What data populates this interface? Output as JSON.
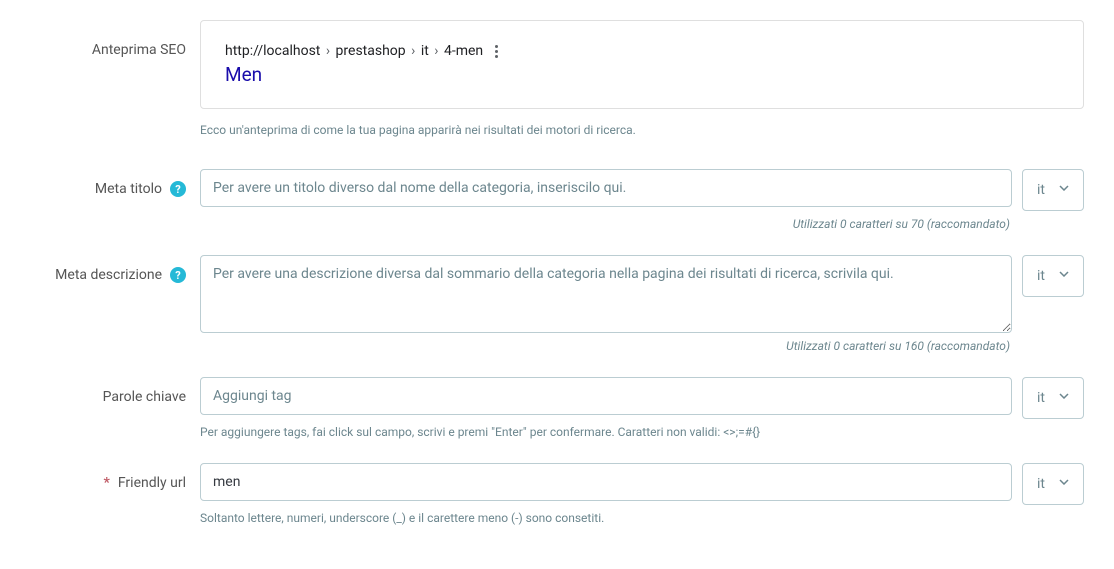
{
  "labels": {
    "seo_preview": "Anteprima SEO",
    "meta_title": "Meta titolo",
    "meta_description": "Meta descrizione",
    "keywords": "Parole chiave",
    "friendly_url": "Friendly url"
  },
  "seo_preview": {
    "url_base": "http://localhost",
    "url_parts": [
      "prestashop",
      "it",
      "4-men"
    ],
    "title": "Men",
    "help_text": "Ecco un'anteprima di come la tua pagina apparirà nei risultati dei motori di ricerca."
  },
  "meta_title": {
    "placeholder": "Per avere un titolo diverso dal nome della categoria, inseriscilo qui.",
    "value": "",
    "counter": "Utilizzati 0 caratteri su 70 (raccomandato)"
  },
  "meta_description": {
    "placeholder": "Per avere una descrizione diversa dal sommario della categoria nella pagina dei risultati di ricerca, scrivila qui.",
    "value": "",
    "counter": "Utilizzati 0 caratteri su 160 (raccomandato)"
  },
  "keywords": {
    "placeholder": "Aggiungi tag",
    "value": "",
    "help_text": "Per aggiungere tags, fai click sul campo, scrivi e premi \"Enter\" per confermare. Caratteri non validi: <>;=#{}"
  },
  "friendly_url": {
    "value": "men",
    "help_text": "Soltanto lettere, numeri, underscore (_) e il carettere meno (-) sono consetiti."
  },
  "lang": {
    "selected": "it"
  }
}
